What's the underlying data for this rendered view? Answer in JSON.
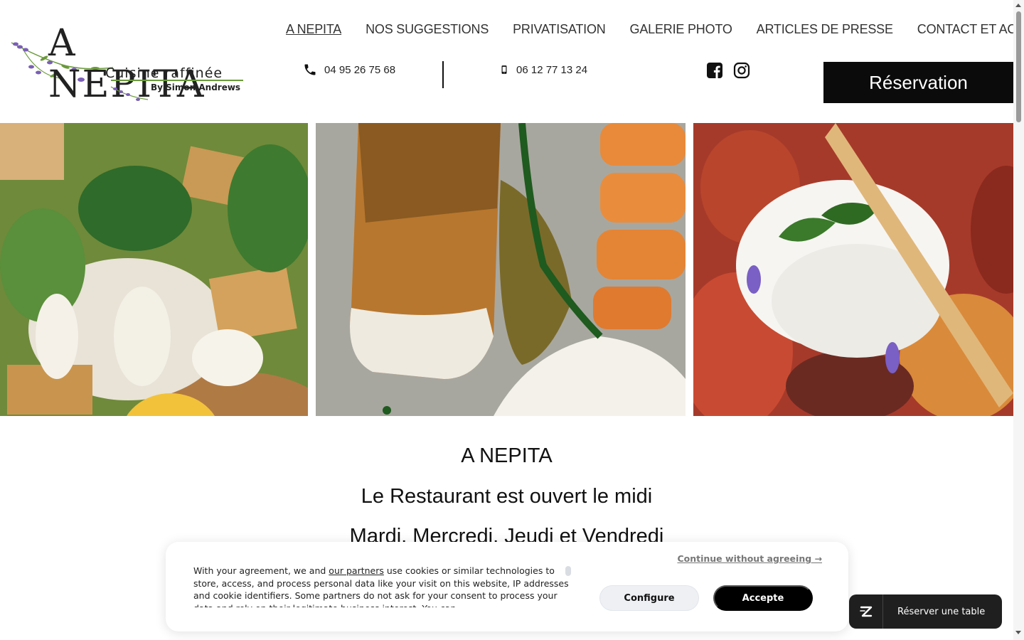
{
  "logo": {
    "title": "A NEPITA",
    "subtitle": "Cuisine raffinée",
    "byline": "By Simon Andrews"
  },
  "nav": {
    "items": [
      {
        "label": "A NEPITA",
        "active": true
      },
      {
        "label": "NOS SUGGESTIONS",
        "active": false
      },
      {
        "label": "PRIVATISATION",
        "active": false
      },
      {
        "label": "GALERIE PHOTO",
        "active": false
      },
      {
        "label": "ARTICLES DE PRESSE",
        "active": false
      },
      {
        "label": "CONTACT ET ACCÈS",
        "active": false
      }
    ]
  },
  "contact": {
    "landline": "04 95 26 75 68",
    "mobile": "06 12 77 13 24",
    "landline_icon": "phone-icon",
    "mobile_icon": "mobile-phone-icon"
  },
  "social": {
    "facebook_icon": "facebook-icon",
    "instagram_icon": "instagram-icon"
  },
  "reservation_button": "Réservation",
  "photos": [
    {
      "icon": "salad-photo"
    },
    {
      "icon": "fish-pasta-photo"
    },
    {
      "icon": "burrata-tomato-photo"
    }
  ],
  "content": {
    "heading": "A NEPITA",
    "line1": "Le Restaurant est ouvert le midi",
    "line2": "Mardi, Mercredi, Jeudi et Vendredi"
  },
  "cookie": {
    "text_before_link": "With your agreement, we and ",
    "link": "our partners",
    "text_after_link": " use cookies or similar technologies to store, access, and process personal data like your visit on this website, IP addresses and cookie identifiers. Some partners do not ask for your consent to process your data and rely on their legitimate business interest. You can",
    "continue": "Continue without agreeing →",
    "configure": "Configure",
    "accept": "Accepte"
  },
  "widget": {
    "label": "Réserver une table",
    "icon": "zenchef-logo-icon"
  },
  "colors": {
    "black": "#0b0b0b",
    "nav_text": "#333333",
    "logo_green": "#6a9a3a",
    "logo_purple": "#7a5fb5"
  }
}
